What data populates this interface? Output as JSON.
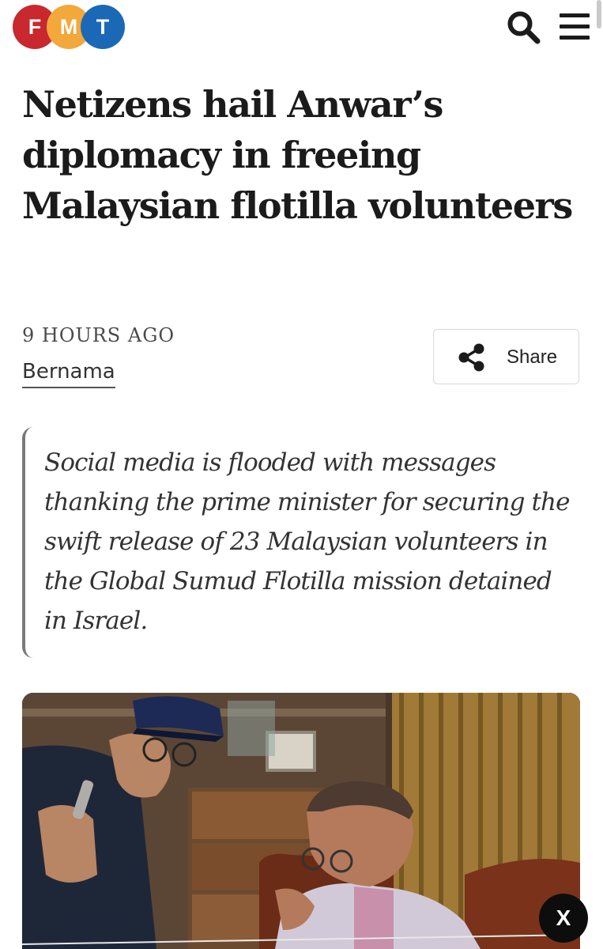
{
  "header": {
    "logo_letters": [
      "F",
      "M",
      "T"
    ],
    "logo_colors": [
      "#c8282e",
      "#f2a83a",
      "#1b69b6"
    ],
    "search_icon": "search-icon",
    "menu_icon": "hamburger-menu-icon"
  },
  "article": {
    "headline": "Netizens hail Anwar’s diplomacy in freeing Malaysian flotilla volunteers",
    "time_ago": "9 HOURS AGO",
    "author": "Bernama",
    "share_label": "Share",
    "share_icon": "share-icon",
    "summary": "Social media is flooded with messages thanking the prime minister for securing the swift release of 23 Malaysian volunteers in the Global Sumud Flotilla mission detained in Israel."
  },
  "overlay": {
    "close_label": "X"
  }
}
